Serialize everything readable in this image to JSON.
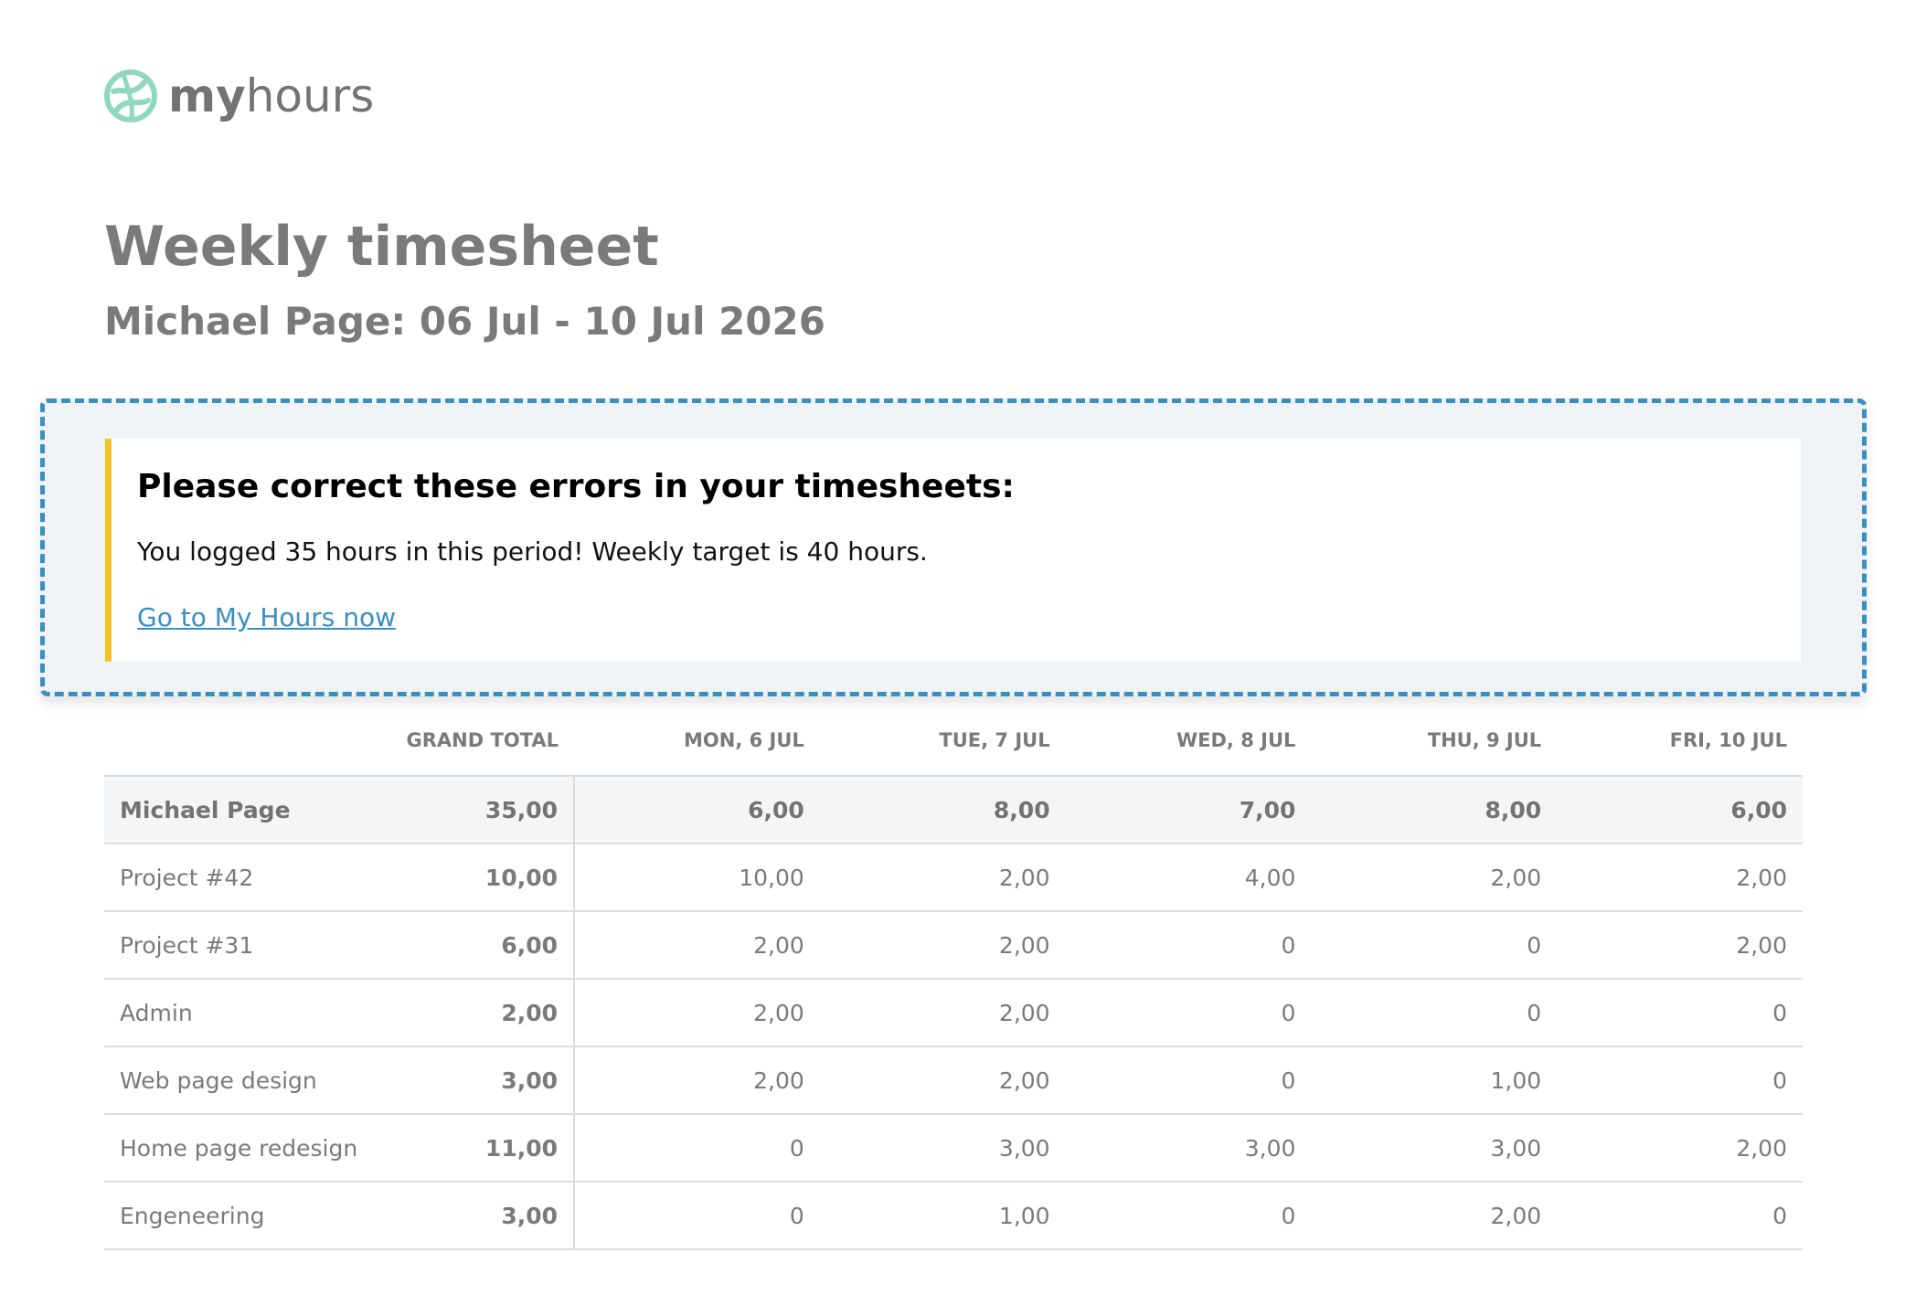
{
  "brand": {
    "logo_icon": "myhours-logo-icon",
    "name_bold": "my",
    "name_regular": "hours",
    "accent_color": "#8fd8be"
  },
  "header": {
    "title": "Weekly timesheet",
    "subtitle": "Michael Page: 06 Jul - 10 Jul 2026"
  },
  "notice": {
    "heading": "Please correct these errors in your timesheets:",
    "message": "You logged 35 hours in this period! Weekly target is 40 hours.",
    "link_label": "Go to My Hours now",
    "border_color": "#3a8fc2",
    "stripe_color": "#f5c323"
  },
  "table": {
    "columns": [
      "",
      "GRAND TOTAL",
      "MON, 6 JUL",
      "TUE, 7 JUL",
      "WED, 8 JUL",
      "THU, 9 JUL",
      "FRI, 10 JUL"
    ],
    "summary": {
      "name": "Michael Page",
      "total": "35,00",
      "days": [
        "6,00",
        "8,00",
        "7,00",
        "8,00",
        "6,00"
      ]
    },
    "rows": [
      {
        "name": "Project #42",
        "total": "10,00",
        "days": [
          "10,00",
          "2,00",
          "4,00",
          "2,00",
          "2,00"
        ]
      },
      {
        "name": "Project #31",
        "total": "6,00",
        "days": [
          "2,00",
          "2,00",
          "0",
          "0",
          "2,00"
        ]
      },
      {
        "name": "Admin",
        "total": "2,00",
        "days": [
          "2,00",
          "2,00",
          "0",
          "0",
          "0"
        ]
      },
      {
        "name": "Web page design",
        "total": "3,00",
        "days": [
          "2,00",
          "2,00",
          "0",
          "1,00",
          "0"
        ]
      },
      {
        "name": "Home page redesign",
        "total": "11,00",
        "days": [
          "0",
          "3,00",
          "3,00",
          "3,00",
          "2,00"
        ]
      },
      {
        "name": "Engeneering",
        "total": "3,00",
        "days": [
          "0",
          "1,00",
          "0",
          "2,00",
          "0"
        ]
      }
    ]
  }
}
